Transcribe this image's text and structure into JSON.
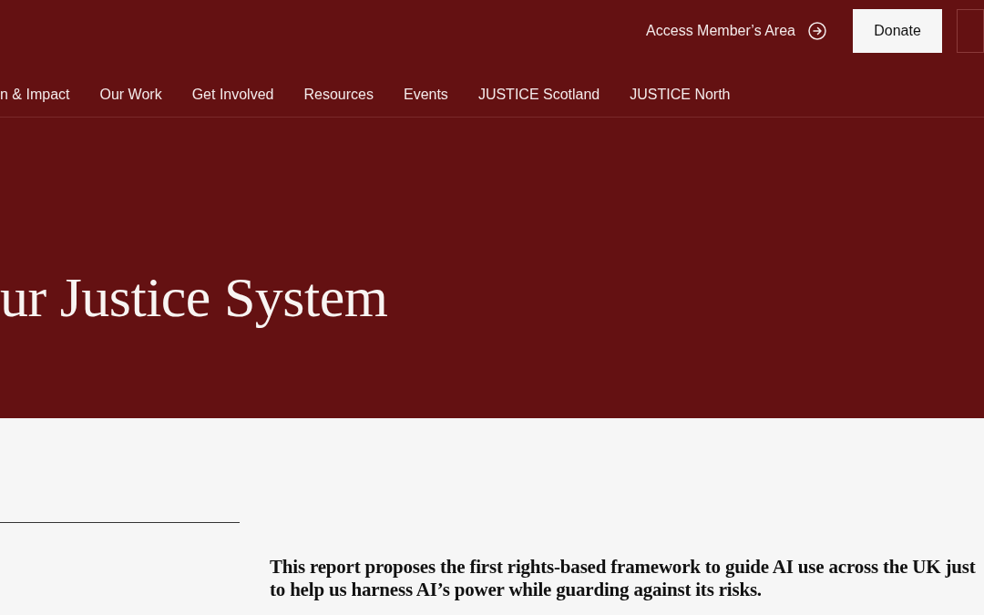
{
  "header": {
    "member_link": "Access Member’s Area",
    "donate_button": "Donate"
  },
  "nav": {
    "items": [
      "n & Impact",
      "Our Work",
      "Get Involved",
      "Resources",
      "Events",
      "JUSTICE Scotland",
      "JUSTICE North"
    ]
  },
  "hero": {
    "title": "ur Justice System"
  },
  "intro": {
    "lines": [
      "This report proposes the first rights-based framework to guide AI use across the UK just",
      "to help us harness AI’s power while guarding against its risks."
    ]
  }
}
